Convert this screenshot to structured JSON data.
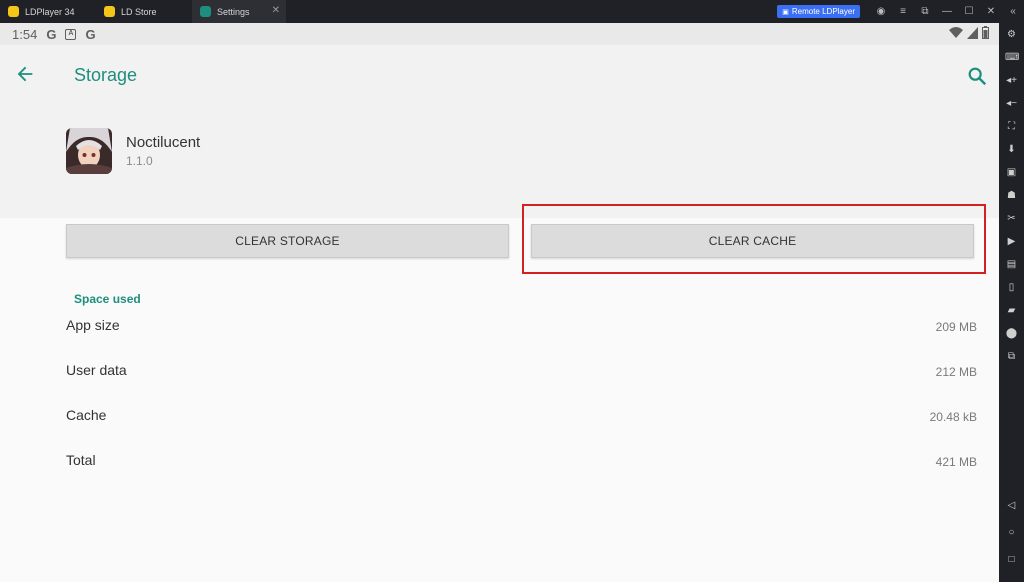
{
  "titlebar": {
    "tabs": [
      {
        "label": "LDPlayer 34",
        "icon": "ldplayer-icon"
      },
      {
        "label": "LD Store",
        "icon": "ld-store-icon"
      },
      {
        "label": "Settings",
        "icon": "settings-gear-icon"
      }
    ],
    "remote_label": "Remote LDPlayer"
  },
  "statusbar": {
    "time": "1:54"
  },
  "header": {
    "title": "Storage",
    "app_name": "Noctilucent",
    "app_version": "1.1.0"
  },
  "buttons": {
    "clear_storage": "CLEAR STORAGE",
    "clear_cache": "CLEAR CACHE"
  },
  "space_used": {
    "title": "Space used",
    "rows": [
      {
        "label": "App size",
        "value": "209 MB"
      },
      {
        "label": "User data",
        "value": "212 MB"
      },
      {
        "label": "Cache",
        "value": "20.48 kB"
      },
      {
        "label": "Total",
        "value": "421 MB"
      }
    ]
  },
  "colors": {
    "accent": "#1e8e7e",
    "highlight": "#d32020",
    "remote_button": "#3b6ff3"
  }
}
